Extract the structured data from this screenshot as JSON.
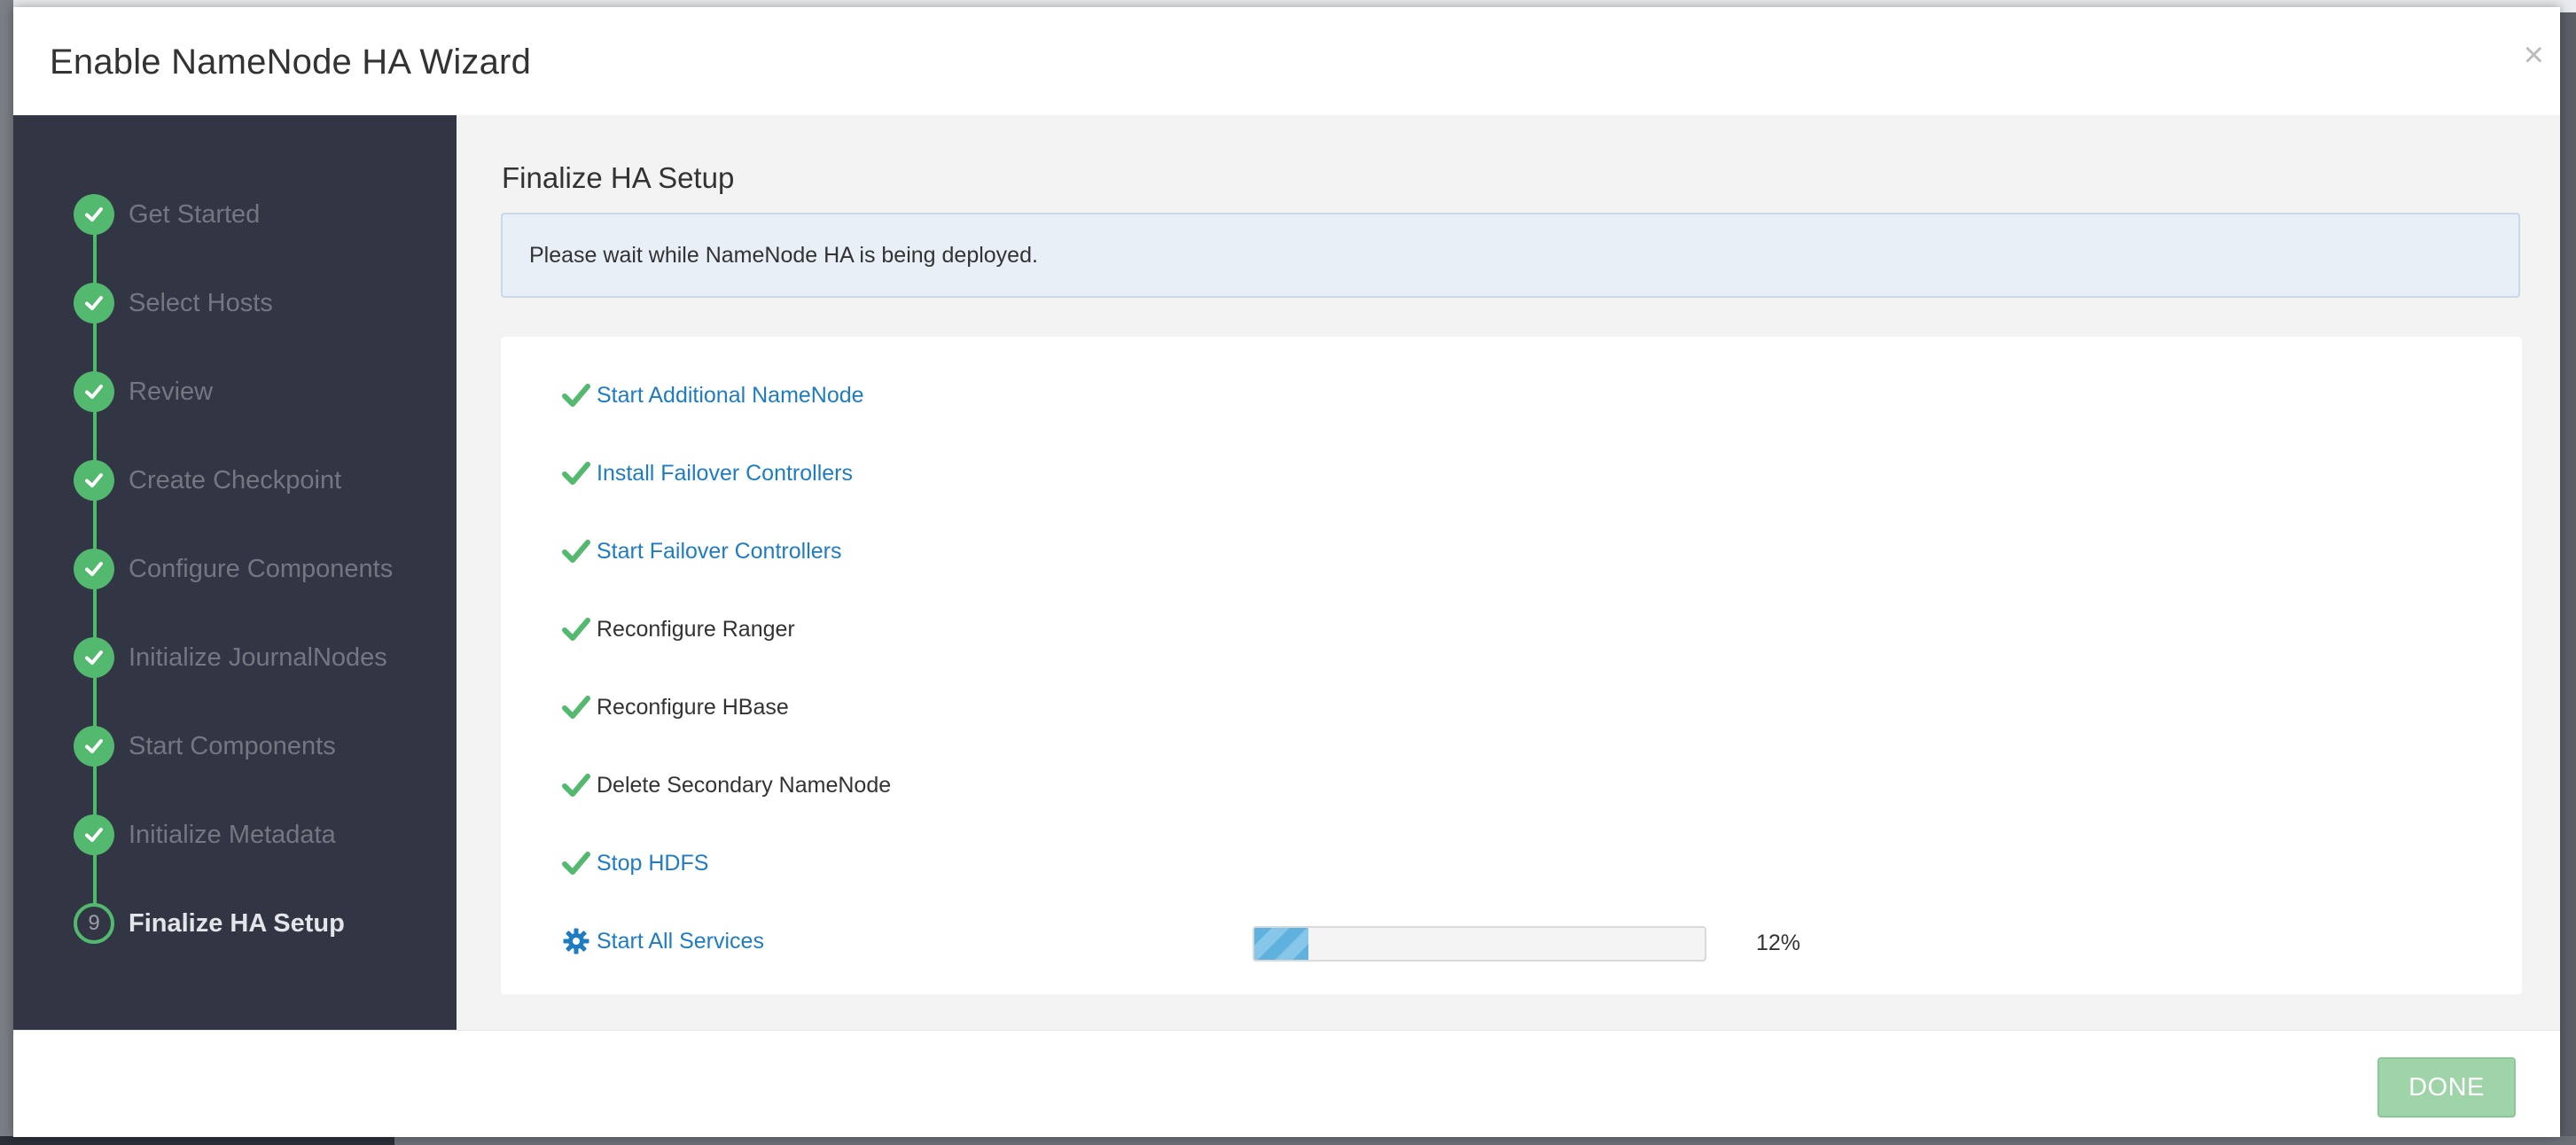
{
  "modal": {
    "title": "Enable NameNode HA Wizard",
    "close_glyph": "×"
  },
  "sidebar": {
    "steps": [
      {
        "label": "Get Started",
        "status": "completed",
        "icon": "check-icon"
      },
      {
        "label": "Select Hosts",
        "status": "completed",
        "icon": "check-icon"
      },
      {
        "label": "Review",
        "status": "completed",
        "icon": "check-icon"
      },
      {
        "label": "Create Checkpoint",
        "status": "completed",
        "icon": "check-icon"
      },
      {
        "label": "Configure Components",
        "status": "completed",
        "icon": "check-icon"
      },
      {
        "label": "Initialize JournalNodes",
        "status": "completed",
        "icon": "check-icon"
      },
      {
        "label": "Start Components",
        "status": "completed",
        "icon": "check-icon"
      },
      {
        "label": "Initialize Metadata",
        "status": "completed",
        "icon": "check-icon"
      },
      {
        "label": "Finalize HA Setup",
        "status": "current",
        "number": "9"
      }
    ]
  },
  "main": {
    "section_title": "Finalize HA Setup",
    "alert_text": "Please wait while NameNode HA is being deployed.",
    "tasks": [
      {
        "label": "Start Additional NameNode",
        "status": "completed",
        "link": true,
        "icon": "check-icon"
      },
      {
        "label": "Install Failover Controllers",
        "status": "completed",
        "link": true,
        "icon": "check-icon"
      },
      {
        "label": "Start Failover Controllers",
        "status": "completed",
        "link": true,
        "icon": "check-icon"
      },
      {
        "label": "Reconfigure Ranger",
        "status": "completed",
        "link": false,
        "icon": "check-icon"
      },
      {
        "label": "Reconfigure HBase",
        "status": "completed",
        "link": false,
        "icon": "check-icon"
      },
      {
        "label": "Delete Secondary NameNode",
        "status": "completed",
        "link": false,
        "icon": "check-icon"
      },
      {
        "label": "Stop HDFS",
        "status": "completed",
        "link": true,
        "icon": "check-icon"
      },
      {
        "label": "Start All Services",
        "status": "in-progress",
        "link": true,
        "icon": "gear-icon"
      }
    ],
    "progress": {
      "value": 12,
      "text": "12%"
    }
  },
  "footer": {
    "done_label": "DONE"
  },
  "colors": {
    "success": "#52b96e",
    "link": "#1f7cc2",
    "sidebar_bg": "#323544",
    "done_button": "#9fd3a8"
  }
}
